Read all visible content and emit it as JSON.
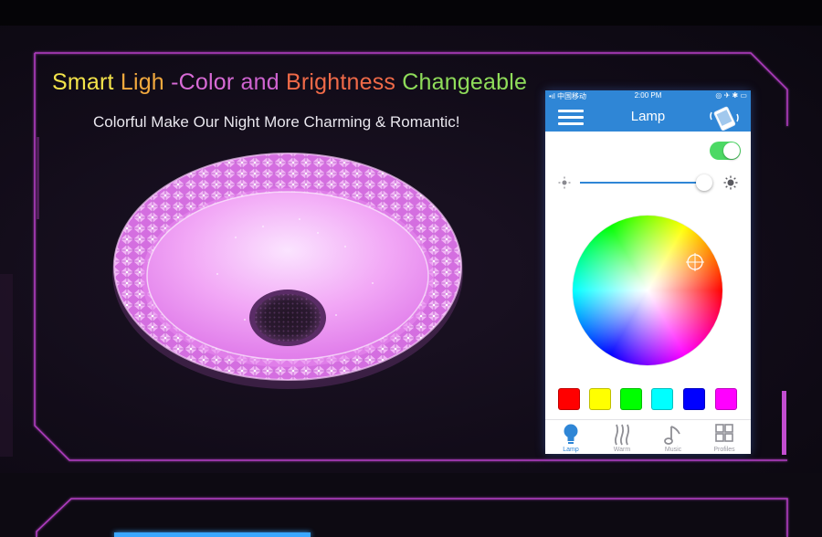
{
  "headline": {
    "words": [
      "Smart",
      "Ligh",
      "-Color",
      "and",
      "Brightness",
      "Changeable"
    ]
  },
  "subheadline": "Colorful Make Our Night More Charming & Romantic!",
  "phone": {
    "status": {
      "carrier": "•ıl 中国移动",
      "time": "2:00 PM",
      "indicators": "◎ ✈ ✱ ▭"
    },
    "nav": {
      "title": "Lamp"
    },
    "power_on": true,
    "brightness_percent": 96,
    "swatches": [
      "#ff0000",
      "#ffff00",
      "#00ff00",
      "#00ffff",
      "#0000ff",
      "#ff00ff"
    ],
    "tabs": [
      {
        "label": "Lamp",
        "icon": "lamp-icon",
        "active": true
      },
      {
        "label": "Warm",
        "icon": "warm-icon",
        "active": false
      },
      {
        "label": "Music",
        "icon": "music-icon",
        "active": false
      },
      {
        "label": "Profiles",
        "icon": "profiles-icon",
        "active": false
      }
    ]
  },
  "colors": {
    "frame": "#b03cc0",
    "accent": "#2f86d6",
    "toggle_on": "#4cd964",
    "lamp_glow": "#e88ff0",
    "bottom_glow": "#3aa7ff"
  }
}
